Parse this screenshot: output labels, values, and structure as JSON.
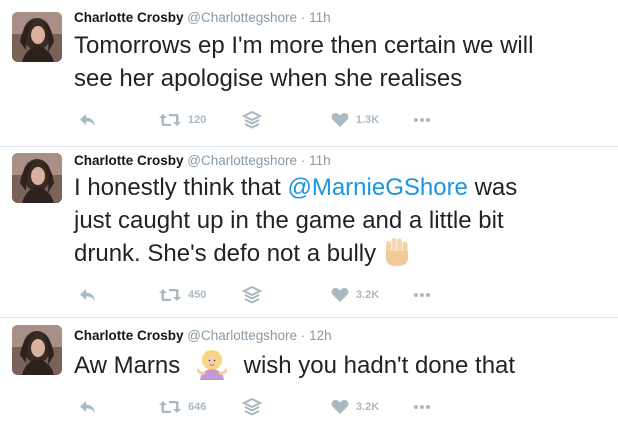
{
  "tweets": [
    {
      "name": "Charlotte Crosby",
      "handle": "@Charlottegshore",
      "time": "· 11h",
      "text_before": "Tomorrows ep I'm more then certain we will",
      "text_line2": "see her apologise when she realises",
      "retweets": "120",
      "likes": "1.3K"
    },
    {
      "name": "Charlotte Crosby",
      "handle": "@Charlottegshore",
      "time": "· 11h",
      "text_line1a": "I honestly think that ",
      "mention": "@MarnieGShore",
      "text_line1b": " was",
      "text_line2": "just caught up in the game and a little bit",
      "text_line3": "drunk. She's defo not a bully",
      "emoji": "raised-hand-emoji",
      "retweets": "450",
      "likes": "3.2K"
    },
    {
      "name": "Charlotte Crosby",
      "handle": "@Charlottegshore",
      "time": "· 12h",
      "text_before": "Aw Marns",
      "emoji": "woman-shrugging-emoji",
      "text_after": "wish you hadn't done that",
      "retweets": "646",
      "likes": "3.2K"
    }
  ],
  "icons": [
    "reply-icon",
    "retweet-icon",
    "stack-icon",
    "heart-icon",
    "more-icon"
  ],
  "colors": {
    "icon": "#aab8c2",
    "mention": "#1b95e0",
    "divider": "#e1e8ed"
  }
}
